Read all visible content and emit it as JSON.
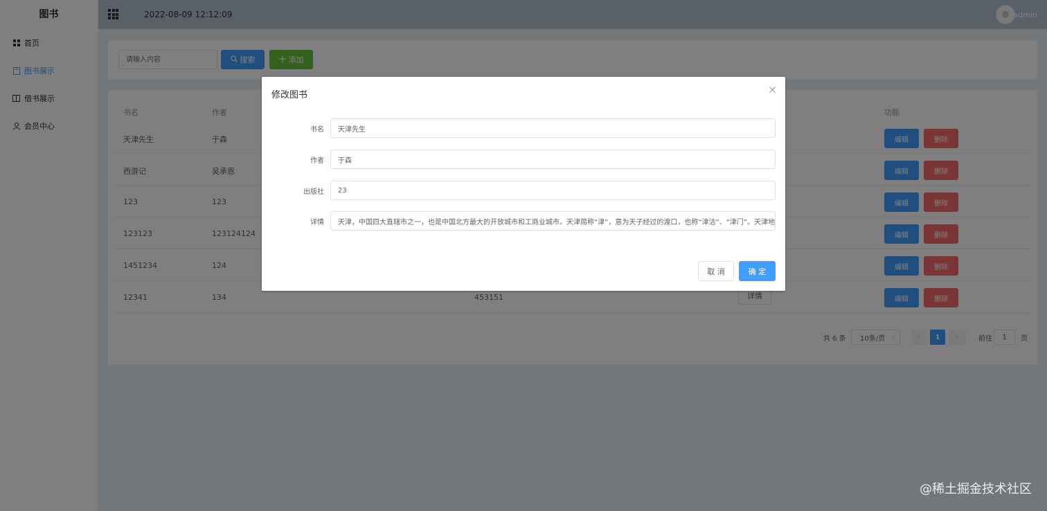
{
  "sidebar": {
    "brand": "图书",
    "items": [
      {
        "label": "首页",
        "icon": "grid-icon"
      },
      {
        "label": "图书展示",
        "icon": "book-icon",
        "active": true
      },
      {
        "label": "借书展示",
        "icon": "open-book-icon"
      },
      {
        "label": "会员中心",
        "icon": "user-icon"
      }
    ]
  },
  "header": {
    "datetime": "2022-08-09 12:12:09",
    "username": "admin"
  },
  "toolbar": {
    "search_placeholder": "请输入内容",
    "search_label": "搜索",
    "add_label": "添加"
  },
  "table": {
    "headers": {
      "name": "书名",
      "author": "作者",
      "actions": "功能"
    },
    "edit_label": "编辑",
    "delete_label": "删除",
    "detail_label": "详情",
    "rows": [
      {
        "name": "天津先生",
        "author": "于森"
      },
      {
        "name": "西游记",
        "author": "吴承恩"
      },
      {
        "name": "123",
        "author": "123"
      },
      {
        "name": "123123",
        "author": "123124124"
      },
      {
        "name": "1451234",
        "author": "124"
      },
      {
        "name": "12341",
        "author": "134",
        "publisher": "453151"
      }
    ]
  },
  "pagination": {
    "total": "共 6 条",
    "page_size": "10条/页",
    "current_page": "1",
    "goto_label": "前往",
    "goto_value": "1",
    "page_suffix": "页"
  },
  "dialog": {
    "title": "修改图书",
    "fields": [
      {
        "label": "书名",
        "value": "天津先生"
      },
      {
        "label": "作者",
        "value": "于森"
      },
      {
        "label": "出版社",
        "value": "23"
      },
      {
        "label": "详情",
        "value": "天津，中国四大直辖市之一，也是中国北方最大的开放城市和工商业城市。天津简称“津”，意为天子经过的渡口，也称“津沽”、“津门”。天津地区"
      }
    ],
    "cancel_label": "取 消",
    "ok_label": "确 定"
  },
  "watermark": "@稀土掘金技术社区",
  "colors": {
    "primary": "#409eff",
    "success": "#67c23a",
    "danger": "#f56c6c",
    "header_bg": "#b3c0d1",
    "main_bg": "#e9eef3"
  }
}
